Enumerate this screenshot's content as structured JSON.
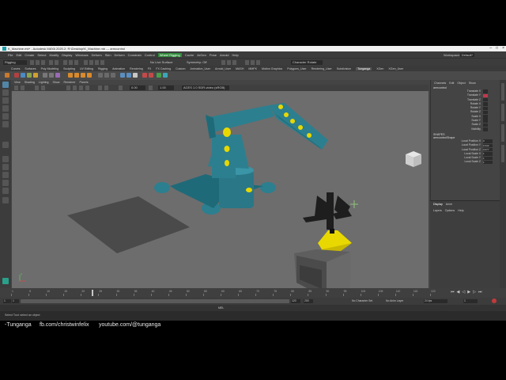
{
  "window": {
    "title": "K_Machine.mb* - Autodesk MAYA 2020.2: R:\\Desktop\\K_Machine.mb  ---  armcontrol",
    "controls": [
      "–",
      "□",
      "×"
    ]
  },
  "menubar": {
    "items": [
      "File",
      "Edit",
      "Create",
      "Select",
      "Modify",
      "Display",
      "Windows",
      "Deform",
      "Skin",
      "Deform",
      "Constrain",
      "Control"
    ],
    "rigging": "Wheel Rigging",
    "extra_items": [
      "Cache",
      "ArGen",
      "Pose",
      "Arnold",
      "Help"
    ],
    "workspace_label": "Workspace:",
    "workspace_value": "Default*"
  },
  "statusline": {
    "mode": "Rigging",
    "no_live": "No Live Surface",
    "symmetry": "Symmetry: Off",
    "panel": "Character Rotate"
  },
  "shelf_tabs": [
    "Curves",
    "Surfaces",
    "Poly Modeling",
    "Sculpting",
    "UV Editing",
    "Rigging",
    "Animation",
    "Rendering",
    "FX",
    "FX Caching",
    "Custom",
    "Animation_User",
    "Arnold_User",
    "MASH",
    "MMFK",
    "Motion Graphics",
    "Polygons_User",
    "Rendering_User",
    "Subdivision",
    "Tunganga",
    "XGen",
    "XGen_User"
  ],
  "shelf_active": "Tunganga",
  "viewport": {
    "menu": [
      "View",
      "Shading",
      "Lighting",
      "Show",
      "Renderer",
      "Panels"
    ],
    "field_a": "0.00",
    "field_b": "1.00",
    "colorspace": "ACES 1.0 SDR-video (sRGB)",
    "axis_label": "y"
  },
  "channelbox": {
    "tabs": [
      "Channels",
      "Edit",
      "Object",
      "Show"
    ],
    "object_name": "armcontrol",
    "attributes": [
      {
        "label": "Translate X",
        "key": false
      },
      {
        "label": "Translate Y",
        "key": true
      },
      {
        "label": "Translate Z",
        "key": false
      },
      {
        "label": "Rotate X",
        "key": false
      },
      {
        "label": "Rotate Y",
        "key": false
      },
      {
        "label": "Rotate Z",
        "key": false
      },
      {
        "label": "Scale X",
        "key": false
      },
      {
        "label": "Scale Y",
        "key": false
      },
      {
        "label": "Scale Z",
        "key": false
      },
      {
        "label": "Visibility",
        "key": false
      }
    ],
    "shapes_label": "SHAPES",
    "shape_name": "armcontrolShape",
    "shape_attrs": [
      "Local Position X",
      "Local Position Y",
      "Local Position Z",
      "Local Scale X",
      "Local Scale Y",
      "Local Scale Z"
    ],
    "shape_values": [
      "0",
      "0.342",
      "0.077",
      "1",
      "1",
      "1"
    ]
  },
  "layers": {
    "tabs": [
      "Display",
      "Anim"
    ],
    "menu": [
      "Layers",
      "Options",
      "Help"
    ]
  },
  "timeline": {
    "ticks": [
      "1",
      "5",
      "10",
      "15",
      "20",
      "25",
      "30",
      "35",
      "40",
      "45",
      "50",
      "55",
      "60",
      "65",
      "70",
      "75",
      "80",
      "85",
      "90",
      "95",
      "100",
      "105",
      "110",
      "115",
      "120"
    ],
    "current_frame": "1",
    "range_start": "1",
    "range_start2": "1",
    "range_end": "120",
    "range_end2": "200",
    "fps": "24 fps",
    "no_char_set": "No Character Set",
    "no_anim_layer": "No Anim Layer"
  },
  "cmdline": {
    "mel": "MEL"
  },
  "helpline": {
    "text": "Select Tool: select an object"
  },
  "footer": {
    "name": "-Tunganga",
    "facebook": "fb.com/christwinfelix",
    "youtube": "youtube.com/@tunganga"
  },
  "colors": {
    "robot_teal": "#2c7f8f",
    "bucket_yellow": "#e8d800",
    "viewport_bg": "#6d6d6d",
    "active_tool": "#5285a6"
  }
}
